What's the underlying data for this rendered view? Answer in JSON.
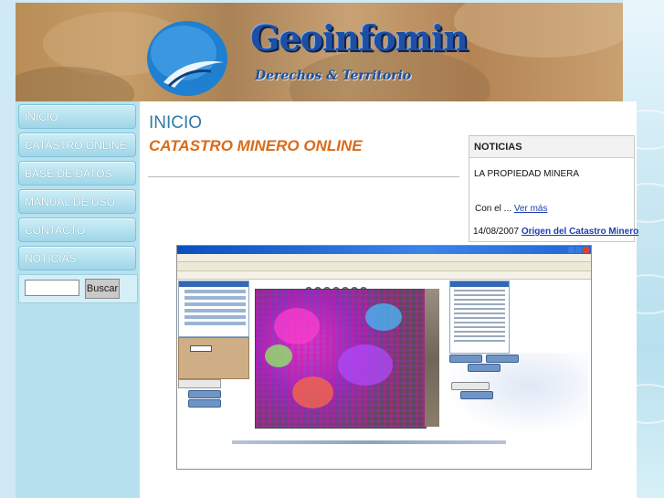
{
  "header": {
    "brand_title": "Geoinfomin",
    "brand_subtitle": "Derechos & Territorio"
  },
  "sidebar": {
    "items": [
      {
        "label": "INICIO"
      },
      {
        "label": "CATASTRO ONLINE"
      },
      {
        "label": "BASE DE DATOS"
      },
      {
        "label": "MANUAL DE USO"
      },
      {
        "label": "CONTACTO"
      },
      {
        "label": "NOTICIAS"
      }
    ],
    "search": {
      "input_value": "",
      "button_label": "Buscar"
    }
  },
  "main": {
    "heading": "INICIO",
    "subheading": "CATASTRO MINERO ONLINE",
    "screenshot_alt_icon": "app-screenshot"
  },
  "news": {
    "title": "NOTICIAS",
    "item_title": "LA PROPIEDAD MINERA",
    "item_excerpt": "Con el ...",
    "more_link": "Ver más",
    "date": "14/08/2007",
    "headline_link": "Origen del Catastro Minero"
  },
  "colors": {
    "nav_button": "#a9dcec",
    "heading_blue": "#2f7aa6",
    "subheading_orange": "#d96b1a",
    "link_blue": "#1e3fb0",
    "brand_blue": "#1e4fa3"
  }
}
